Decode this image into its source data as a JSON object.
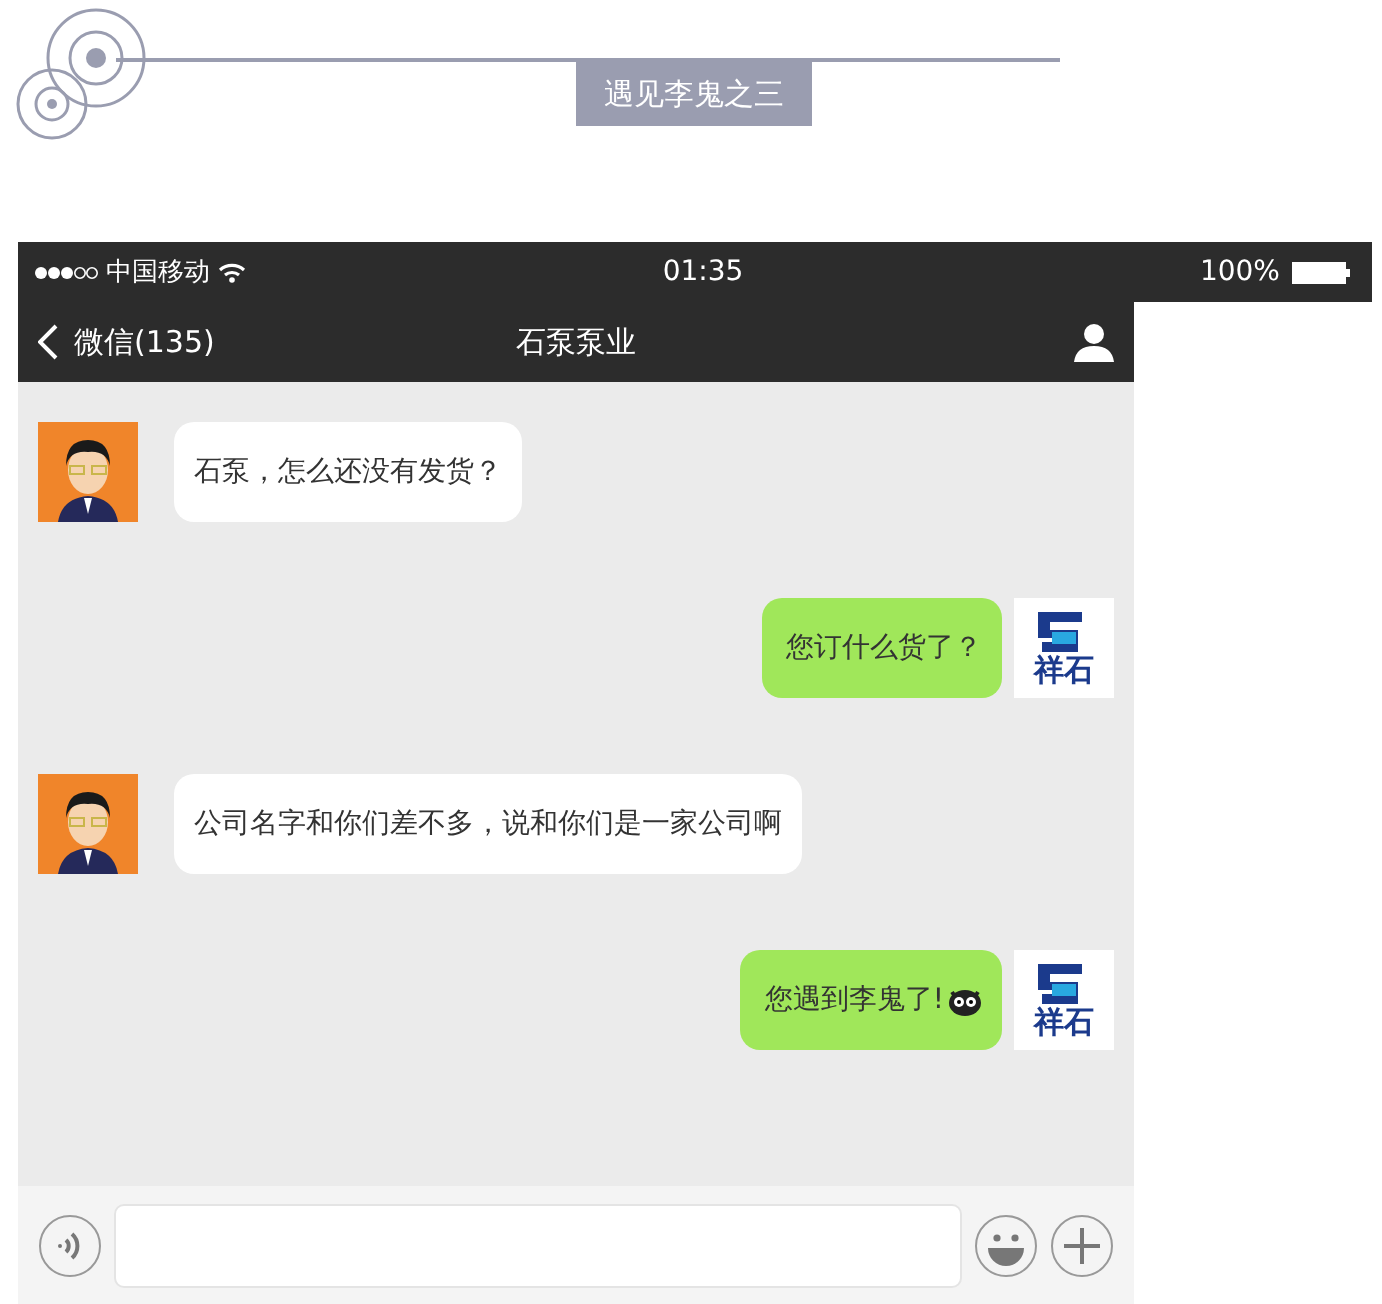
{
  "banner": {
    "title": "遇见李鬼之三"
  },
  "status_bar": {
    "carrier": "中国移动",
    "time": "01:35",
    "battery": "100%"
  },
  "nav": {
    "back": "微信(135)",
    "title": "石泵泵业"
  },
  "messages": [
    {
      "kind": "received",
      "text": "石泵，怎么还没有发货？"
    },
    {
      "kind": "sent",
      "text": "您订什么货了？",
      "logo_text": "祥石"
    },
    {
      "kind": "received",
      "text": "公司名字和你们差不多，说和你们是一家公司啊"
    },
    {
      "kind": "sent",
      "text": "您遇到李鬼了!",
      "emoji": true,
      "logo_text": "祥石"
    }
  ]
}
